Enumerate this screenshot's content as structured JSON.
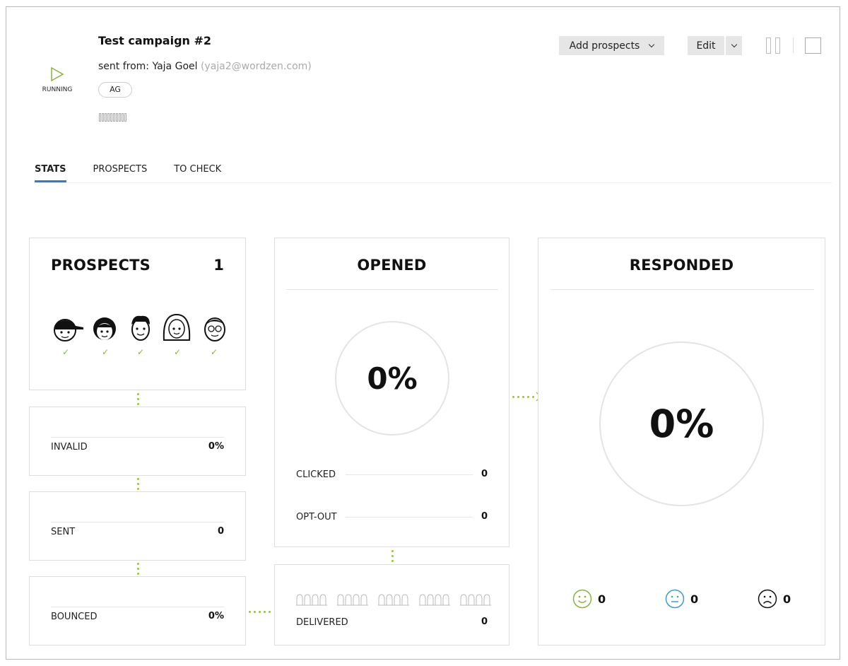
{
  "campaign": {
    "status": "RUNNING",
    "title": "Test campaign #2",
    "sent_from_prefix": "sent from: ",
    "sender_name": "Yaja Goel",
    "sender_email": "(yaja2@wordzen.com)",
    "tag": "AG"
  },
  "toolbar": {
    "add_prospects": "Add prospects",
    "edit": "Edit"
  },
  "tabs": [
    {
      "label": "STATS",
      "active": true
    },
    {
      "label": "PROSPECTS",
      "active": false
    },
    {
      "label": "TO CHECK",
      "active": false
    }
  ],
  "prospects": {
    "title": "PROSPECTS",
    "count": "1",
    "avatars": [
      "cap-boy",
      "girl",
      "boy",
      "long-hair-woman",
      "glasses-man"
    ]
  },
  "invalid": {
    "label": "INVALID",
    "value": "0%"
  },
  "sent": {
    "label": "SENT",
    "value": "0"
  },
  "bounced": {
    "label": "BOUNCED",
    "value": "0%"
  },
  "opened": {
    "title": "OPENED",
    "percent": "0%",
    "clicked_label": "CLICKED",
    "clicked_value": "0",
    "optout_label": "OPT-OUT",
    "optout_value": "0"
  },
  "delivered": {
    "label": "DELIVERED",
    "value": "0"
  },
  "responded": {
    "title": "RESPONDED",
    "percent": "0%",
    "positive": "0",
    "neutral": "0",
    "negative": "0"
  },
  "colors": {
    "accent": "#2b7dd1",
    "green": "#8ab33a",
    "blue": "#3a9bd8"
  }
}
